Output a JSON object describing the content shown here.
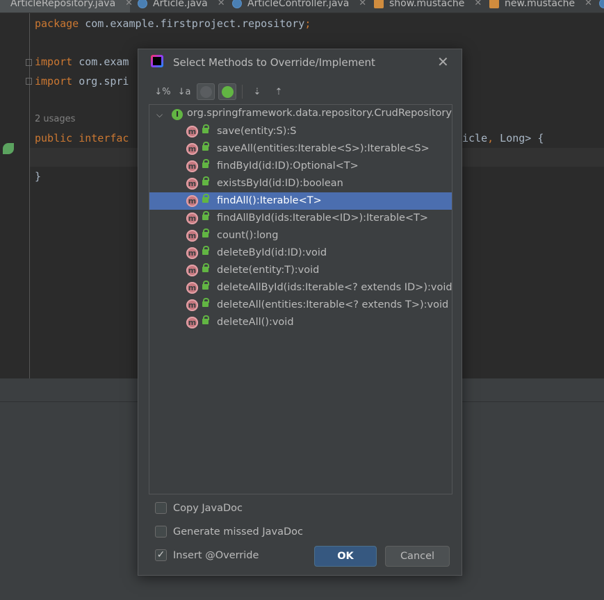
{
  "tabs": [
    {
      "label": "ArticleRepository.java",
      "icon": "interface-icon",
      "active": true
    },
    {
      "label": "Article.java",
      "icon": "class-icon"
    },
    {
      "label": "ArticleController.java",
      "icon": "class-icon"
    },
    {
      "label": "show.mustache",
      "icon": "mustache-icon"
    },
    {
      "label": "new.mustache",
      "icon": "mustache-icon"
    }
  ],
  "tab_close_glyph": "✕",
  "editor": {
    "line_package_kw": "package",
    "line_package_rest": " com.example.firstproject.repository",
    "line_package_semicolon": ";",
    "line_import1_kw": "import",
    "line_import1_rest": " com.exam",
    "line_import2_kw": "import",
    "line_import2_rest": " org.spri",
    "usages": "2 usages",
    "decl_kw1": "public",
    "decl_kw2": " interfac",
    "decl_tail_1": "icle",
    "decl_tail_comma": ",",
    "decl_tail_2": " Long> {",
    "closing_brace": "}"
  },
  "dialog": {
    "title": "Select Methods to Override/Implement",
    "close_glyph": "✕",
    "toolbar": {
      "sort_visibility": "↓%",
      "sort_alpha": "↓a",
      "collapse_glyph": "⇡",
      "expand_glyph": "⇣"
    },
    "tree": {
      "root_icon_letter": "I",
      "root_label": "org.springframework.data.repository.CrudRepository",
      "method_icon_letter": "m",
      "selected_index": 4,
      "methods": [
        "save(entity:S):S",
        "saveAll(entities:Iterable<S>):Iterable<S>",
        "findById(id:ID):Optional<T>",
        "existsById(id:ID):boolean",
        "findAll():Iterable<T>",
        "findAllById(ids:Iterable<ID>):Iterable<T>",
        "count():long",
        "deleteById(id:ID):void",
        "delete(entity:T):void",
        "deleteAllById(ids:Iterable<? extends ID>):void",
        "deleteAll(entities:Iterable<? extends T>):void",
        "deleteAll():void"
      ]
    },
    "options": {
      "copy_javadoc": {
        "label": "Copy JavaDoc",
        "checked": false
      },
      "generate_javadoc": {
        "label": "Generate missed JavaDoc",
        "checked": false
      },
      "insert_override": {
        "label": "Insert @Override",
        "checked": true
      }
    },
    "check_glyph": "✓",
    "ok_label": "OK",
    "cancel_label": "Cancel"
  }
}
